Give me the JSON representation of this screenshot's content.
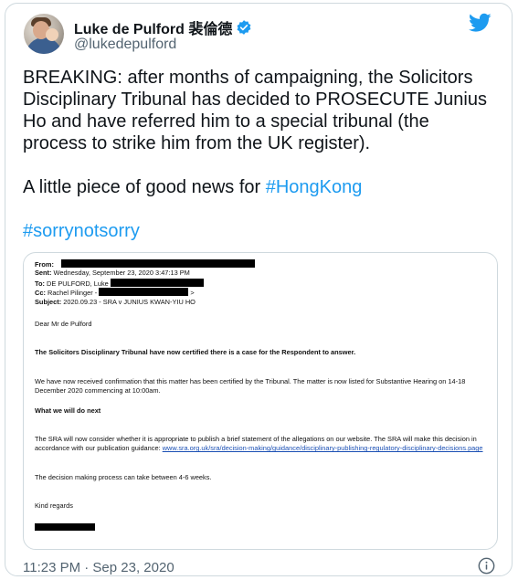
{
  "author": {
    "display_name": "Luke de Pulford 裴倫德",
    "handle": "@lukedepulford",
    "verified": true
  },
  "tweet": {
    "paragraph1": "BREAKING: after months of campaigning, the Solicitors Disciplinary Tribunal has decided to PROSECUTE Junius Ho and have referred him to a special tribunal (the process to strike him from the UK register).",
    "paragraph2_prefix": "A little piece of good news for ",
    "paragraph2_hashtag": "#HongKong",
    "paragraph3_hashtag": "#sorrynotsorry",
    "timestamp": "11:23 PM · Sep 23, 2020"
  },
  "email": {
    "from_label": "From:",
    "sent_label": "Sent:",
    "sent_value": "Wednesday, September 23, 2020 3:47:13 PM",
    "to_label": "To:",
    "to_value": "DE PULFORD, Luke",
    "cc_label": "Cc:",
    "cc_value": "Rachel Pilinger -",
    "cc_suffix": ">",
    "subject_label": "Subject:",
    "subject_value": "2020.09.23 - SRA v JUNIUS KWAN-YIU HO",
    "greeting": "Dear Mr de Pulford",
    "bold_notice": "The Solicitors Disciplinary Tribunal have now certified there is a case for the Respondent to answer.",
    "para1": "We have now received confirmation that this matter has been certified by the Tribunal. The matter is now listed for Substantive Hearing on 14-18 December 2020 commencing at 10:00am.",
    "section_heading": "What we will do next",
    "para2": "The SRA will now consider whether it is appropriate to publish a brief statement of the allegations on our website. The SRA will make this decision in accordance with our publication guidance:",
    "link_text": "www.sra.org.uk/sra/decision-making/guidance/disciplinary-publishing-regulatory-disciplinary-decisions.page",
    "para3": "The decision making process can take between 4-6 weeks.",
    "signoff": "Kind regards"
  },
  "icons": {
    "verified": "verified-badge-icon",
    "logo": "twitter-bird-icon",
    "info": "info-icon"
  },
  "colors": {
    "accent": "#1d9bf0",
    "text": "#0f1419",
    "secondary": "#536471",
    "border": "#cfd9de"
  }
}
